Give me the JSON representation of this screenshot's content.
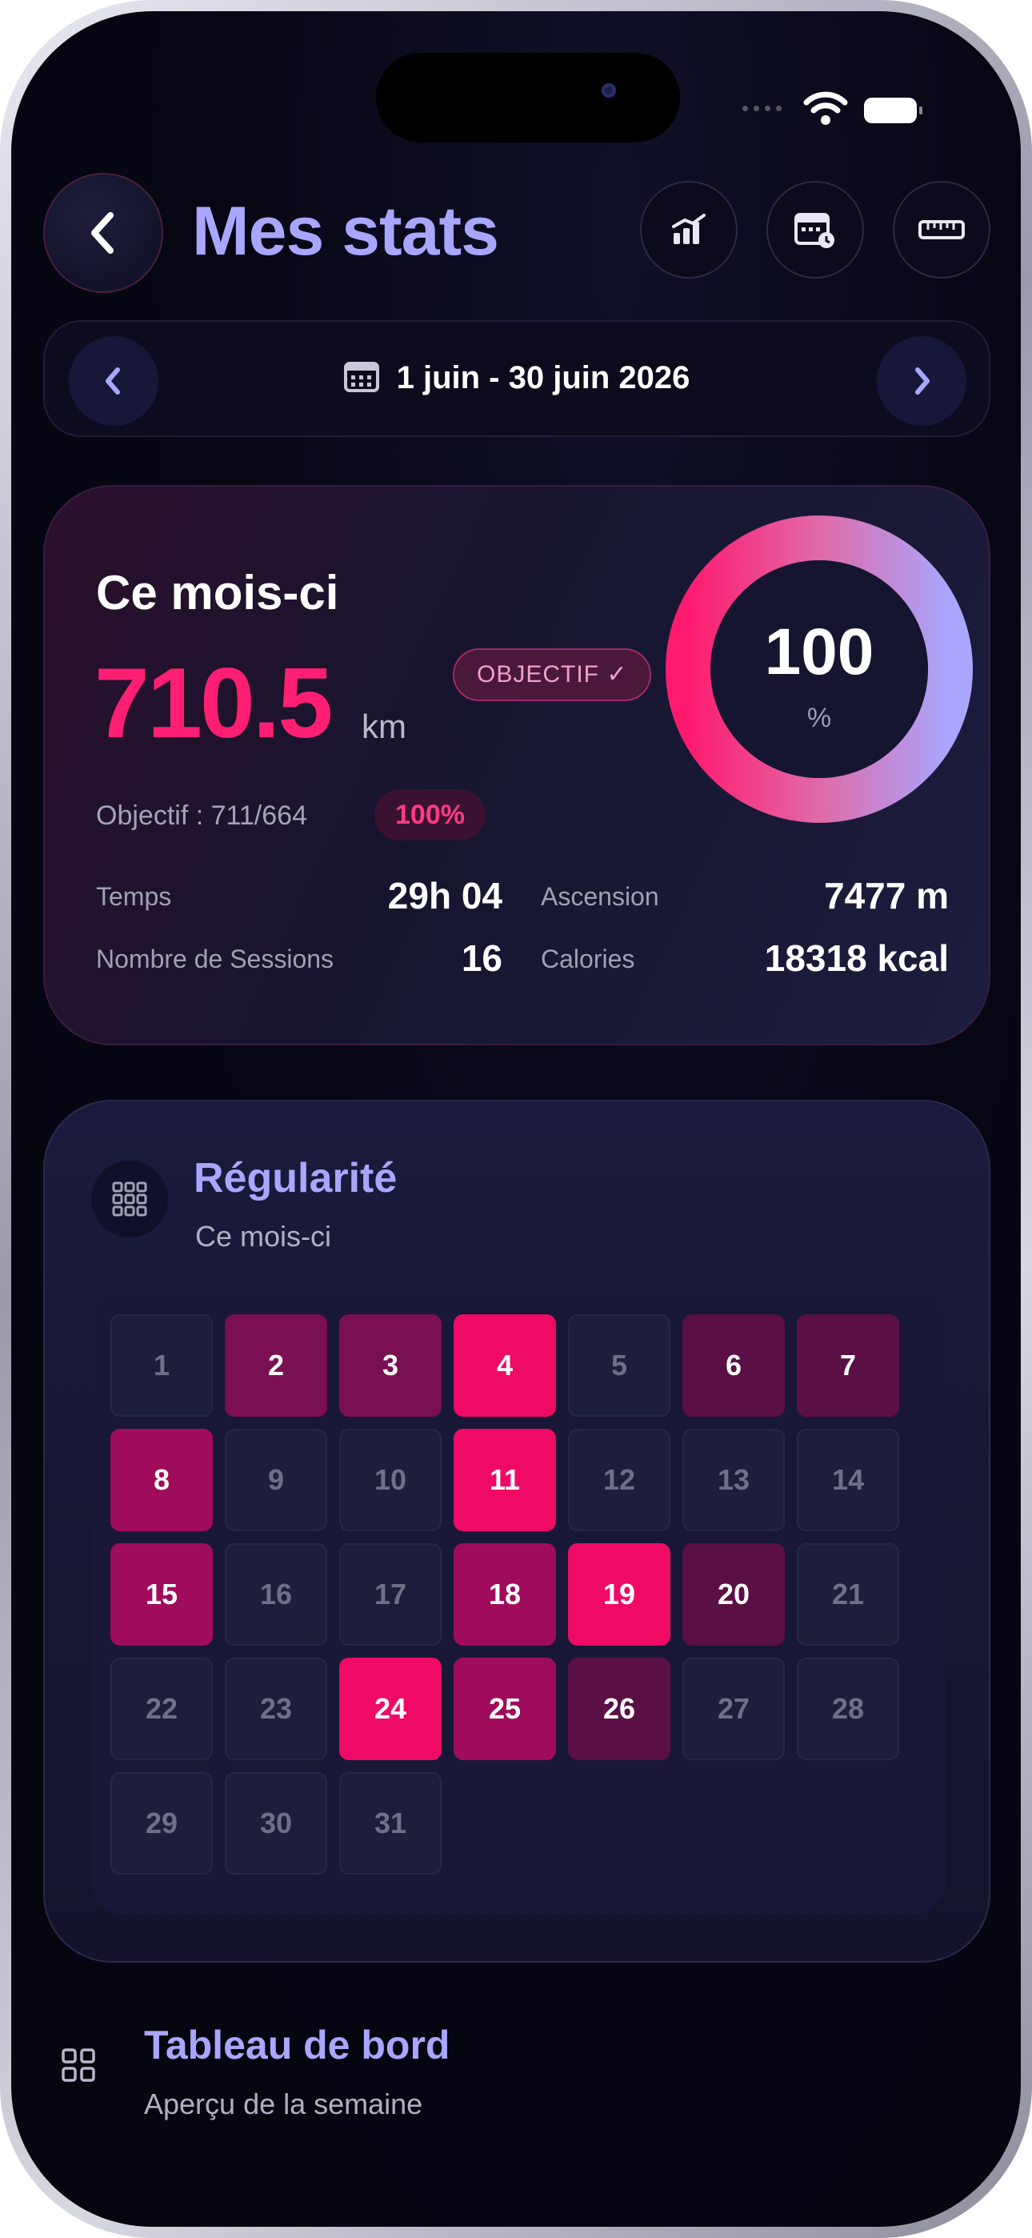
{
  "header": {
    "title": "Mes stats"
  },
  "date_range": {
    "label": "1 juin - 30 juin 2026"
  },
  "month_card": {
    "title": "Ce mois-ci",
    "distance_value": "710.5",
    "distance_unit": "km",
    "objective_badge": "OBJECTIF ✓",
    "goal_text": "Objectif : 711/664",
    "goal_percent_badge": "100%",
    "ring_value": "100",
    "ring_unit": "%",
    "ring_progress": 1.0,
    "stats": {
      "time_label": "Temps",
      "time_value": "29h 04",
      "sessions_label": "Nombre de Sessions",
      "sessions_value": "16",
      "climb_label": "Ascension",
      "climb_value": "7477 m",
      "calories_label": "Calories",
      "calories_value": "18318 kcal"
    }
  },
  "regularity": {
    "title": "Régularité",
    "subtitle": "Ce mois-ci",
    "days": [
      {
        "n": "1",
        "level": 0
      },
      {
        "n": "2",
        "level": 2
      },
      {
        "n": "3",
        "level": 2
      },
      {
        "n": "4",
        "level": 4
      },
      {
        "n": "5",
        "level": 0
      },
      {
        "n": "6",
        "level": 1
      },
      {
        "n": "7",
        "level": 1
      },
      {
        "n": "8",
        "level": 3
      },
      {
        "n": "9",
        "level": 0
      },
      {
        "n": "10",
        "level": 0
      },
      {
        "n": "11",
        "level": 4
      },
      {
        "n": "12",
        "level": 0
      },
      {
        "n": "13",
        "level": 0
      },
      {
        "n": "14",
        "level": 0
      },
      {
        "n": "15",
        "level": 3
      },
      {
        "n": "16",
        "level": 0
      },
      {
        "n": "17",
        "level": 0
      },
      {
        "n": "18",
        "level": 3
      },
      {
        "n": "19",
        "level": 4
      },
      {
        "n": "20",
        "level": 1
      },
      {
        "n": "21",
        "level": 0
      },
      {
        "n": "22",
        "level": 0
      },
      {
        "n": "23",
        "level": 0
      },
      {
        "n": "24",
        "level": 4
      },
      {
        "n": "25",
        "level": 3
      },
      {
        "n": "26",
        "level": 1
      },
      {
        "n": "27",
        "level": 0
      },
      {
        "n": "28",
        "level": 0
      },
      {
        "n": "29",
        "level": 0
      },
      {
        "n": "30",
        "level": 0
      },
      {
        "n": "31",
        "level": 0
      }
    ]
  },
  "dashboard": {
    "title": "Tableau de bord",
    "subtitle": "Aperçu de la semaine"
  },
  "icons": {
    "back": "chevron-left-icon",
    "chart": "chart-bars-icon",
    "calendar_plus": "calendar-icon",
    "ruler": "ruler-icon",
    "prev": "chevron-left-icon",
    "next": "chevron-right-icon",
    "grid": "grid-icon"
  },
  "colors": {
    "accent_pink": "#ff1f72",
    "title_violet": "#a9a6ff"
  }
}
